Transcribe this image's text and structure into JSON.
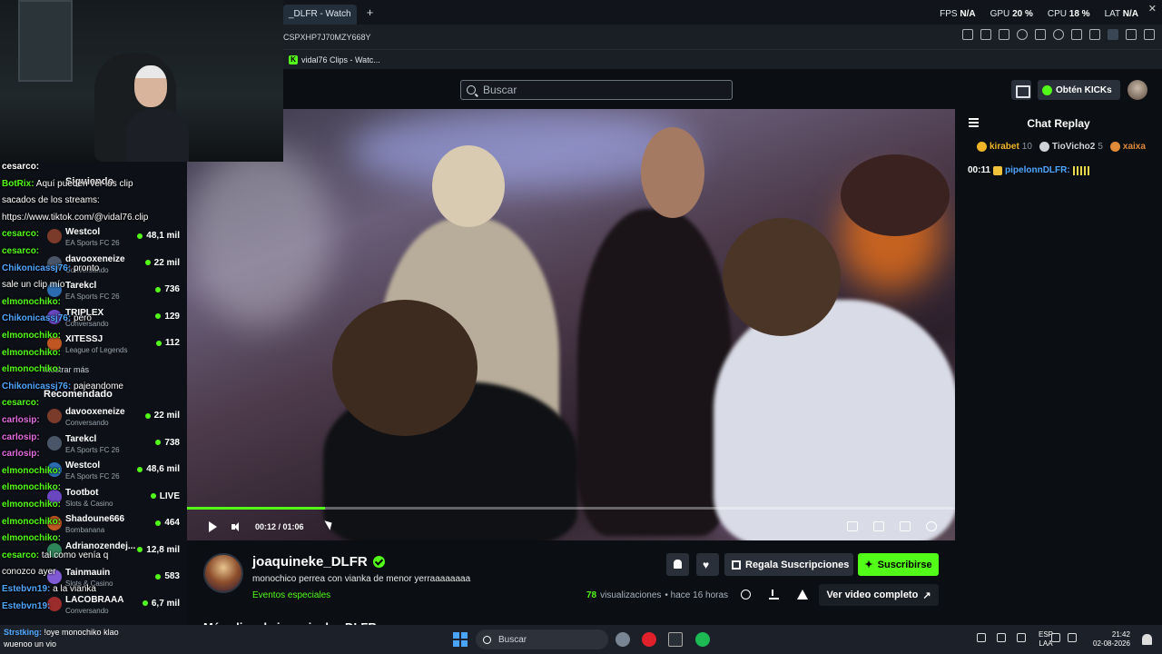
{
  "browser": {
    "tab_title": "_DLFR - Watch",
    "url": "CSPXHP7J70MZY668Y",
    "bookmark": "vidal76 Clips - Watc...",
    "perf": {
      "fps_label": "FPS",
      "fps": "N/A",
      "gpu_label": "GPU",
      "gpu": "20 %",
      "cpu_label": "CPU",
      "cpu": "18 %",
      "lat_label": "LAT",
      "lat": "N/A"
    }
  },
  "header": {
    "search_placeholder": "Buscar",
    "kicks_label": "Obtén KICKs"
  },
  "player": {
    "time": "00:12 / 01:06",
    "progress": 0.18
  },
  "info": {
    "channel": "joaquineke_DLFR",
    "title": "monochico  perrea con vianka de menor yerraaaaaaaa",
    "category": "Eventos especiales",
    "views": "78",
    "views_label": "visualizaciones",
    "ago": "• hace 16 horas",
    "gift_label": "Regala Suscripciones",
    "subscribe_label": "Suscribirse",
    "full_video_label": "Ver video completo",
    "more_heading": "Más clips de joaquineke_DLFR"
  },
  "chat_replay": {
    "title": "Chat Replay",
    "leaders": [
      {
        "name": "kirabet",
        "count": "10",
        "color": "#f0b429"
      },
      {
        "name": "TioVicho2",
        "count": "5",
        "color": "#d0d4d8"
      },
      {
        "name": "xaixa",
        "count": "",
        "color": "#e08a3a"
      }
    ],
    "message": {
      "time": "00:11",
      "user": "pipelonnDLFR:"
    }
  },
  "sidebar": {
    "following": "Siguiendo",
    "recommended": "Recomendado",
    "show_more": "Mostrar más",
    "following_items": [
      {
        "name": "Westcol",
        "category": "EA Sports FC 26",
        "viewers": "48,1 mil"
      },
      {
        "name": "davooxeneize",
        "category": "Conversando",
        "viewers": "22 mil"
      },
      {
        "name": "Tarekcl",
        "category": "EA Sports FC 26",
        "viewers": "736"
      },
      {
        "name": "TRIPLEX",
        "category": "Conversando",
        "viewers": "129"
      },
      {
        "name": "XITESSJ",
        "category": "League of Legends",
        "viewers": "112"
      }
    ],
    "recommended_items": [
      {
        "name": "davooxeneize",
        "category": "Conversando",
        "viewers": "22 mil"
      },
      {
        "name": "Tarekcl",
        "category": "EA Sports FC 26",
        "viewers": "738"
      },
      {
        "name": "Westcol",
        "category": "EA Sports FC 26",
        "viewers": "48,6 mil"
      },
      {
        "name": "Tootbot",
        "category": "Slots & Casino",
        "viewers": "LIVE"
      },
      {
        "name": "Shadoune666",
        "category": "Bombanana",
        "viewers": "464"
      },
      {
        "name": "Adrianozendej...",
        "category": "",
        "viewers": "12,8 mil"
      },
      {
        "name": "Tainmauin",
        "category": "Slots & Casino",
        "viewers": "583"
      },
      {
        "name": "LACOBRAAA",
        "category": "Conversando",
        "viewers": "6,7 mil"
      }
    ]
  },
  "overlay_chat": [
    {
      "user": "cesarco:",
      "text": "",
      "color": "#ffffff"
    },
    {
      "user": "BotRix:",
      "text": "Aquí pueden ver los clip",
      "color": "#53fc18"
    },
    {
      "user": "",
      "text": "sacados de los streams:",
      "color": "#ffffff"
    },
    {
      "user": "",
      "text": "https://www.tiktok.com/@vidal76.clip",
      "color": "#ffffff"
    },
    {
      "user": "cesarco:",
      "text": "",
      "color": "#53fc18"
    },
    {
      "user": "cesarco:",
      "text": "",
      "color": "#53fc18"
    },
    {
      "user": "Chikonicassj76:",
      "text": "pronto",
      "color": "#4ea6ff"
    },
    {
      "user": "",
      "text": "sale un clip mío",
      "color": "#ffffff"
    },
    {
      "user": "elmonochiko:",
      "text": "",
      "color": "#53fc18"
    },
    {
      "user": "Chikonicassj76:",
      "text": "pero",
      "color": "#4ea6ff"
    },
    {
      "user": "elmonochiko:",
      "text": "",
      "color": "#53fc18"
    },
    {
      "user": "elmonochiko:",
      "text": "",
      "color": "#53fc18"
    },
    {
      "user": "elmonochiko:",
      "text": "",
      "color": "#53fc18"
    },
    {
      "user": "Chikonicassj76:",
      "text": "pajeandome",
      "color": "#4ea6ff"
    },
    {
      "user": "cesarco:",
      "text": "",
      "color": "#53fc18"
    },
    {
      "user": "carlosip:",
      "text": "",
      "color": "#e36ce0"
    },
    {
      "user": "carlosip:",
      "text": "",
      "color": "#e36ce0"
    },
    {
      "user": "carlosip:",
      "text": "",
      "color": "#e36ce0"
    },
    {
      "user": "elmonochiko:",
      "text": "",
      "color": "#53fc18"
    },
    {
      "user": "elmonochiko:",
      "text": "",
      "color": "#53fc18"
    },
    {
      "user": "elmonochiko:",
      "text": "",
      "color": "#53fc18"
    },
    {
      "user": "elmonochiko:",
      "text": "",
      "color": "#53fc18"
    },
    {
      "user": "elmonochiko:",
      "text": "",
      "color": "#53fc18"
    },
    {
      "user": "cesarco:",
      "text": "tal como venía q",
      "color": "#53fc18"
    },
    {
      "user": "",
      "text": "conozco ayer",
      "color": "#ffffff"
    },
    {
      "user": "Estebvn19:",
      "text": "a la vianka",
      "color": "#4ea6ff"
    },
    {
      "user": "Estebvn19:",
      "text": "",
      "color": "#4ea6ff"
    }
  ],
  "taskbar": {
    "chat_user": "Strstking:",
    "chat_text": "!oye monochiko klao",
    "chat_text2": "wuenoo un vio",
    "search": "Buscar",
    "lang1": "ESP",
    "lang2": "LAA",
    "time": "21:42",
    "date": "02-08-2026"
  }
}
